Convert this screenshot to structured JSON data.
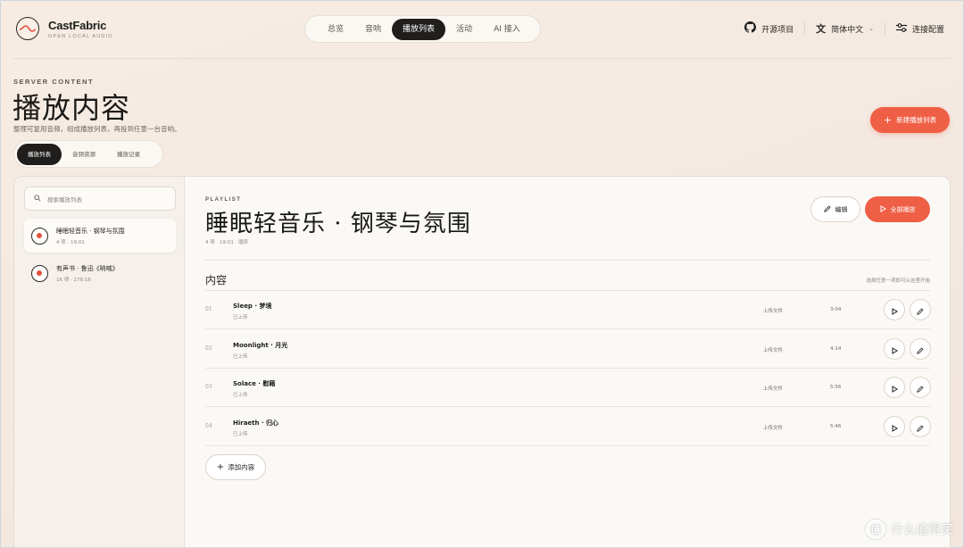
{
  "brand": {
    "name": "CastFabric",
    "tagline": "OPEN LOCAL AUDIO"
  },
  "nav": {
    "tabs": [
      {
        "label": "总览"
      },
      {
        "label": "音响"
      },
      {
        "label": "播放列表",
        "active": true
      },
      {
        "label": "活动"
      },
      {
        "label": "AI 接入"
      }
    ]
  },
  "topright": {
    "github": "开源项目",
    "lang": "简体中文",
    "settings": "连接配置"
  },
  "header": {
    "eyebrow": "SERVER CONTENT",
    "title": "播放内容",
    "desc": "整理可复用音频，组成播放列表，再投到任意一台音响。",
    "new_button": "新建播放列表"
  },
  "subtabs": [
    {
      "label": "播放列表",
      "active": true
    },
    {
      "label": "音频资源"
    },
    {
      "label": "播放记录"
    }
  ],
  "sidebar": {
    "search_placeholder": "搜索播放列表",
    "playlists": [
      {
        "name": "睡眠轻音乐 · 钢琴与氛围",
        "meta": "4 项 · 19:01",
        "selected": true
      },
      {
        "name": "有声书 · 鲁迅《呐喊》",
        "meta": "16 项 · 278:16"
      }
    ]
  },
  "playlist": {
    "eyebrow": "PLAYLIST",
    "title": "睡眠轻音乐 · 钢琴与氛围",
    "meta": "4 项 · 19:01 · 顺序",
    "edit": "编辑",
    "play_all": "全部播放",
    "section_title": "内容",
    "section_hint": "选择任意一项即可从这里开始",
    "items": [
      {
        "idx": "01",
        "title": "Sleep · 梦境",
        "status": "已上传",
        "source": "上传文件",
        "duration": "3:04"
      },
      {
        "idx": "02",
        "title": "Moonlight · 月光",
        "status": "已上传",
        "source": "上传文件",
        "duration": "4:14"
      },
      {
        "idx": "03",
        "title": "Solace · 慰藉",
        "status": "已上传",
        "source": "上传文件",
        "duration": "5:56"
      },
      {
        "idx": "04",
        "title": "Hiraeth · 归心",
        "status": "已上传",
        "source": "上传文件",
        "duration": "5:46"
      }
    ],
    "add_button": "添加内容"
  },
  "watermark": {
    "mark": "值",
    "text": "什么值得买"
  },
  "colors": {
    "accent": "#ef5f45",
    "dark": "#1f1e1c",
    "bg": "#f5ece4"
  }
}
